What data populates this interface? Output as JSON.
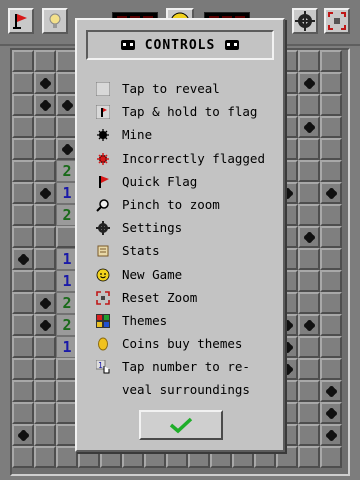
{
  "topbar": {
    "buttons_left": [
      "flag-icon",
      "lightbulb-icon"
    ],
    "buttons_right": [
      "gear-icon",
      "reset-zoom-icon"
    ]
  },
  "board": {
    "colors": {
      "covered": "#7f7f7f",
      "open": "#9a9a9a",
      "num1": "#1a1aa8",
      "num2": "#1a6a1a"
    },
    "left_numbers": [
      {
        "row": 5,
        "col": 2,
        "value": "2"
      },
      {
        "row": 6,
        "col": 2,
        "value": "1"
      },
      {
        "row": 7,
        "col": 2,
        "value": "2"
      },
      {
        "row": 9,
        "col": 2,
        "value": "1"
      },
      {
        "row": 10,
        "col": 2,
        "value": "1"
      },
      {
        "row": 11,
        "col": 2,
        "value": "2"
      },
      {
        "row": 12,
        "col": 2,
        "value": "2"
      },
      {
        "row": 13,
        "col": 2,
        "value": "1"
      }
    ]
  },
  "dialog": {
    "title": "CONTROLS",
    "items": [
      {
        "icon": "covered-tile-icon",
        "label": "Tap to reveal"
      },
      {
        "icon": "flag-tile-icon",
        "label": "Tap & hold to flag"
      },
      {
        "icon": "mine-icon",
        "label": "Mine"
      },
      {
        "icon": "incorrect-flag-icon",
        "label": "Incorrectly flagged"
      },
      {
        "icon": "quick-flag-icon",
        "label": "Quick Flag"
      },
      {
        "icon": "magnifier-icon",
        "label": "Pinch to zoom"
      },
      {
        "icon": "gear-icon",
        "label": "Settings"
      },
      {
        "icon": "scroll-icon",
        "label": "Stats"
      },
      {
        "icon": "smiley-icon",
        "label": "New Game"
      },
      {
        "icon": "reset-zoom-icon",
        "label": "Reset Zoom"
      },
      {
        "icon": "themes-icon",
        "label": "Themes"
      },
      {
        "icon": "coin-icon",
        "label": "Coins buy themes"
      },
      {
        "icon": "tap-number-icon",
        "label": "Tap number to re-"
      },
      {
        "icon": "",
        "label": "veal surroundings"
      }
    ],
    "ok_icon": "checkmark-icon",
    "accent": "#1fae2a"
  }
}
